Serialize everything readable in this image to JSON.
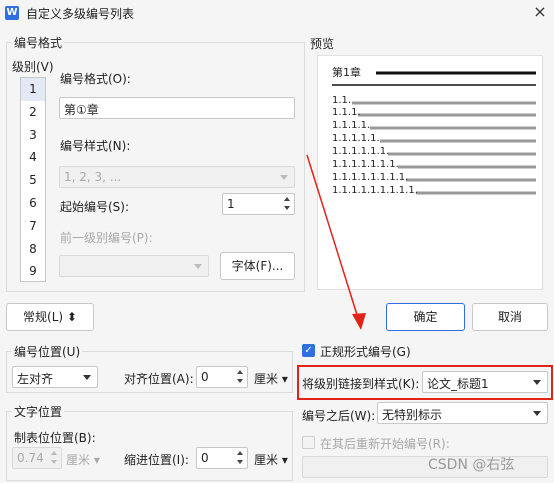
{
  "window": {
    "title": "自定义多级编号列表",
    "app_icon_letter": "W",
    "close": "×"
  },
  "number_format": {
    "group_title": "编号格式",
    "level_label": "级别(V)",
    "levels": [
      "1",
      "2",
      "3",
      "4",
      "5",
      "6",
      "7",
      "8",
      "9"
    ],
    "selected_level": "1",
    "format_label": "编号格式(O):",
    "format_value": "第①章",
    "style_label": "编号样式(N):",
    "style_value": "1, 2, 3, ...",
    "start_label": "起始编号(S):",
    "start_value": "1",
    "prev_level_label": "前一级别编号(P):",
    "prev_level_value": "",
    "font_button": "字体(F)..."
  },
  "preview": {
    "group_title": "预览",
    "heading": "第1章",
    "items": [
      "1.1.",
      "1.1.1.",
      "1.1.1.1.",
      "1.1.1.1.1.",
      "1.1.1.1.1.1.",
      "1.1.1.1.1.1.1.",
      "1.1.1.1.1.1.1.1.",
      "1.1.1.1.1.1.1.1.1."
    ]
  },
  "buttons": {
    "normal": "常规(L)",
    "normal_toggle_icon": "⬍",
    "ok": "确定",
    "cancel": "取消"
  },
  "number_position": {
    "group_title": "编号位置(U)",
    "align_value": "左对齐",
    "align_pos_label": "对齐位置(A):",
    "align_pos_value": "0",
    "unit": "厘米"
  },
  "text_position": {
    "group_title": "文字位置",
    "tab_label": "制表位位置(B):",
    "tab_value": "0.74",
    "tab_unit": "厘米",
    "indent_label": "缩进位置(I):",
    "indent_value": "0",
    "indent_unit": "厘米"
  },
  "options": {
    "legal_style_label": "正规形式编号(G)",
    "legal_style_checked": true,
    "link_label": "将级别链接到样式(K):",
    "link_value": "论文_标题1",
    "after_label": "编号之后(W):",
    "after_value": "无特别标示",
    "restart_label": "在其后重新开始编号(R):",
    "restart_value": ""
  },
  "watermark": "CSDN @右弦",
  "colors": {
    "accent": "#2f6fe0",
    "highlight": "#e2231a",
    "arrow": "#e2231a"
  }
}
